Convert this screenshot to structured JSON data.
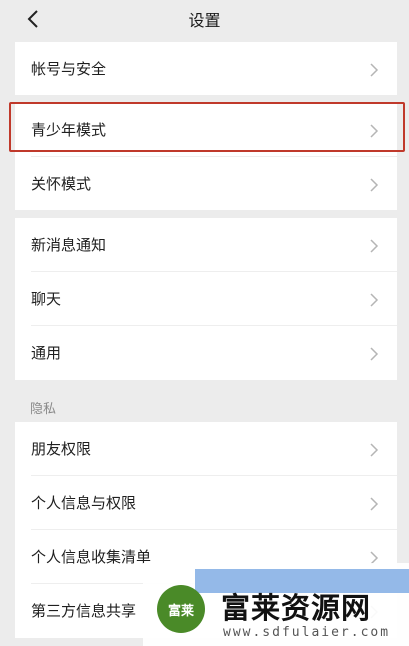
{
  "header": {
    "title": "设置"
  },
  "groups": [
    {
      "items": [
        {
          "label": "帐号与安全"
        }
      ]
    },
    {
      "items": [
        {
          "label": "青少年模式"
        },
        {
          "label": "关怀模式"
        }
      ]
    },
    {
      "items": [
        {
          "label": "新消息通知"
        },
        {
          "label": "聊天"
        },
        {
          "label": "通用"
        }
      ]
    }
  ],
  "privacy": {
    "title": "隐私",
    "items": [
      {
        "label": "朋友权限"
      },
      {
        "label": "个人信息与权限"
      },
      {
        "label": "个人信息收集清单"
      },
      {
        "label": "第三方信息共享"
      }
    ]
  },
  "watermark": {
    "title": "富莱资源网",
    "url": "www.sdfulaier.com",
    "logo_text": "富莱"
  },
  "colors": {
    "highlight": "#c0392b",
    "background": "#ececec"
  }
}
